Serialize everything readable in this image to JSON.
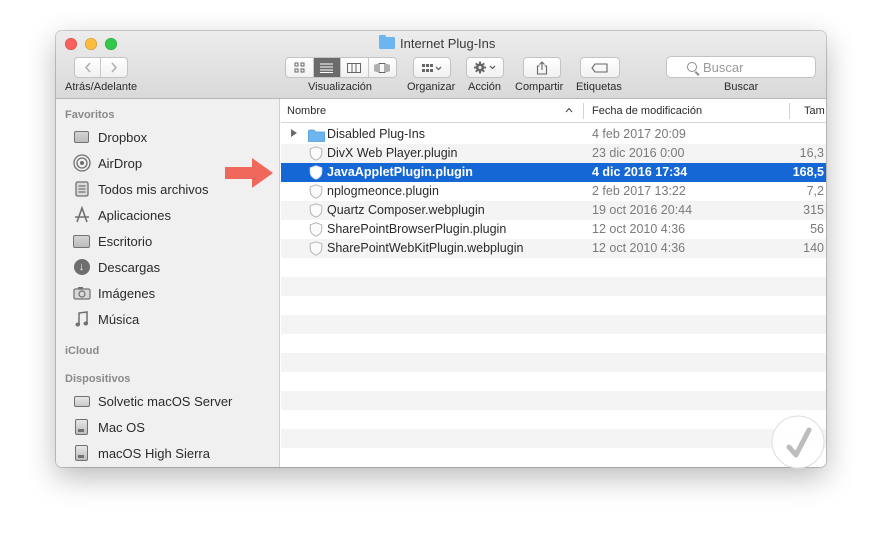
{
  "window": {
    "title": "Internet Plug-Ins"
  },
  "toolbar": {
    "nav_label": "Atrás/Adelante",
    "view_label": "Visualización",
    "arrange_label": "Organizar",
    "action_label": "Acción",
    "share_label": "Compartir",
    "tags_label": "Etiquetas",
    "search_label": "Buscar",
    "search_placeholder": "Buscar"
  },
  "sidebar": {
    "favorites_header": "Favoritos",
    "favorites": [
      {
        "label": "Dropbox",
        "icon": "dropbox-icon"
      },
      {
        "label": "AirDrop",
        "icon": "airdrop-icon"
      },
      {
        "label": "Todos mis archivos",
        "icon": "all-files-icon"
      },
      {
        "label": "Aplicaciones",
        "icon": "applications-icon"
      },
      {
        "label": "Escritorio",
        "icon": "desktop-icon"
      },
      {
        "label": "Descargas",
        "icon": "downloads-icon"
      },
      {
        "label": "Imágenes",
        "icon": "pictures-icon"
      },
      {
        "label": "Música",
        "icon": "music-icon"
      }
    ],
    "icloud_header": "iCloud",
    "devices_header": "Dispositivos",
    "devices": [
      {
        "label": "Solvetic macOS Server",
        "icon": "computer-icon"
      },
      {
        "label": "Mac OS",
        "icon": "hard-disk-icon"
      },
      {
        "label": "macOS High Sierra",
        "icon": "hard-disk-icon"
      }
    ]
  },
  "list": {
    "col_name": "Nombre",
    "col_date": "Fecha de modificación",
    "col_size": "Tam",
    "files": [
      {
        "name": "Disabled Plug-Ins",
        "date": "4 feb 2017 20:09",
        "size": "",
        "kind": "folder",
        "selected": false
      },
      {
        "name": "DivX Web Player.plugin",
        "date": "23 dic 2016 0:00",
        "size": "16,3",
        "kind": "plugin",
        "selected": false
      },
      {
        "name": "JavaAppletPlugin.plugin",
        "date": "4 dic 2016 17:34",
        "size": "168,5",
        "kind": "plugin",
        "selected": true
      },
      {
        "name": "nplogmeonce.plugin",
        "date": "2 feb 2017 13:22",
        "size": "7,2",
        "kind": "plugin",
        "selected": false
      },
      {
        "name": "Quartz Composer.webplugin",
        "date": "19 oct 2016 20:44",
        "size": "315",
        "kind": "plugin",
        "selected": false
      },
      {
        "name": "SharePointBrowserPlugin.plugin",
        "date": "12 oct 2010 4:36",
        "size": "56",
        "kind": "plugin",
        "selected": false
      },
      {
        "name": "SharePointWebKitPlugin.webplugin",
        "date": "12 oct 2010 4:36",
        "size": "140",
        "kind": "plugin",
        "selected": false
      }
    ]
  },
  "colors": {
    "selection": "#1667d6",
    "arrow": "#f0685b",
    "close": "#fc605c",
    "minimize": "#fdbc40",
    "maximize": "#34c84a"
  }
}
